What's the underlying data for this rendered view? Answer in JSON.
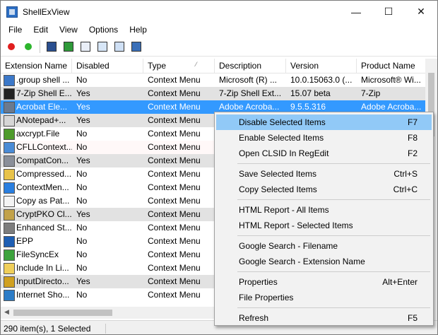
{
  "window": {
    "title": "ShellExView",
    "minimize": "—",
    "maximize": "☐",
    "close": "✕"
  },
  "menu": [
    "File",
    "Edit",
    "View",
    "Options",
    "Help"
  ],
  "columns": {
    "name": "Extension Name",
    "disabled": "Disabled",
    "type": "Type",
    "description": "Description",
    "version": "Version",
    "product": "Product Name"
  },
  "rows": [
    {
      "name": ".group shell ...",
      "disabled": "No",
      "type": "Context Menu",
      "description": "Microsoft (R) ...",
      "version": "10.0.15063.0 (...",
      "product": "Microsoft® Wi...",
      "style": "",
      "icon": "gear-doc-icon",
      "color": "#3b78c9"
    },
    {
      "name": "7-Zip Shell E...",
      "disabled": "Yes",
      "type": "Context Menu",
      "description": "7-Zip Shell Ext...",
      "version": "15.07 beta",
      "product": "7-Zip",
      "style": "grey",
      "icon": "7zip-icon",
      "color": "#222222"
    },
    {
      "name": "Acrobat Ele...",
      "disabled": "Yes",
      "type": "Context Menu",
      "description": "Adobe Acroba...",
      "version": "9.5.5.316",
      "product": "Adobe Acroba...",
      "style": "selected",
      "icon": "acrobat-icon",
      "color": "#6b7a8f"
    },
    {
      "name": "ANotepad+...",
      "disabled": "Yes",
      "type": "Context Menu",
      "description": "",
      "version": "",
      "product": "",
      "style": "grey",
      "icon": "notepad-icon",
      "color": "#d6d6d6"
    },
    {
      "name": "axcrypt.File",
      "disabled": "No",
      "type": "Context Menu",
      "description": "",
      "version": "",
      "product": "",
      "style": "",
      "icon": "shield-icon",
      "color": "#4d9b2c"
    },
    {
      "name": "CFLLContext...",
      "disabled": "No",
      "type": "Context Menu",
      "description": "",
      "version": "",
      "product": "",
      "style": "pinkish",
      "icon": "magnifier-icon",
      "color": "#4a8bd6"
    },
    {
      "name": "CompatCon...",
      "disabled": "Yes",
      "type": "Context Menu",
      "description": "",
      "version": "",
      "product": "",
      "style": "grey",
      "icon": "compat-icon",
      "color": "#8a8f99"
    },
    {
      "name": "Compressed...",
      "disabled": "No",
      "type": "Context Menu",
      "description": "",
      "version": "",
      "product": "",
      "style": "",
      "icon": "zip-folder-icon",
      "color": "#e8c34a"
    },
    {
      "name": "ContextMen...",
      "disabled": "No",
      "type": "Context Menu",
      "description": "",
      "version": "",
      "product": "",
      "style": "",
      "icon": "dropbox-icon",
      "color": "#2a7fe0"
    },
    {
      "name": "Copy as Pat...",
      "disabled": "No",
      "type": "Context Menu",
      "description": "",
      "version": "",
      "product": "",
      "style": "",
      "icon": "document-icon",
      "color": "#f4f4f4"
    },
    {
      "name": "CryptPKO Cl...",
      "disabled": "Yes",
      "type": "Context Menu",
      "description": "",
      "version": "",
      "product": "",
      "style": "grey",
      "icon": "certificate-icon",
      "color": "#c2a24a"
    },
    {
      "name": "Enhanced St...",
      "disabled": "No",
      "type": "Context Menu",
      "description": "",
      "version": "",
      "product": "",
      "style": "",
      "icon": "drive-icon",
      "color": "#7d7d7d"
    },
    {
      "name": "EPP",
      "disabled": "No",
      "type": "Context Menu",
      "description": "",
      "version": "",
      "product": "",
      "style": "",
      "icon": "epp-icon",
      "color": "#1e5fb4"
    },
    {
      "name": "FileSyncEx",
      "disabled": "No",
      "type": "Context Menu",
      "description": "",
      "version": "",
      "product": "",
      "style": "",
      "icon": "sync-check-icon",
      "color": "#3da33d"
    },
    {
      "name": "Include In Li...",
      "disabled": "No",
      "type": "Context Menu",
      "description": "",
      "version": "",
      "product": "",
      "style": "",
      "icon": "folder-icon",
      "color": "#f0cf5a"
    },
    {
      "name": "InputDirecto...",
      "disabled": "Yes",
      "type": "Context Menu",
      "description": "",
      "version": "",
      "product": "",
      "style": "grey",
      "icon": "input-icon",
      "color": "#d0a020"
    },
    {
      "name": "Internet Sho...",
      "disabled": "No",
      "type": "Context Menu",
      "description": "",
      "version": "",
      "product": "",
      "style": "",
      "icon": "globe-icon",
      "color": "#2b7cc7"
    }
  ],
  "status": {
    "count": "290 item(s), 1 Selected"
  },
  "context_menu": [
    {
      "label": "Disable Selected Items",
      "key": "F7",
      "highlight": true
    },
    {
      "label": "Enable Selected Items",
      "key": "F8"
    },
    {
      "label": "Open CLSID In RegEdit",
      "key": "F2"
    },
    {
      "sep": true
    },
    {
      "label": "Save Selected Items",
      "key": "Ctrl+S"
    },
    {
      "label": "Copy Selected Items",
      "key": "Ctrl+C"
    },
    {
      "sep": true
    },
    {
      "label": "HTML Report - All Items",
      "key": ""
    },
    {
      "label": "HTML Report - Selected Items",
      "key": ""
    },
    {
      "sep": true
    },
    {
      "label": "Google Search - Filename",
      "key": ""
    },
    {
      "label": "Google Search - Extension Name",
      "key": ""
    },
    {
      "sep": true
    },
    {
      "label": "Properties",
      "key": "Alt+Enter"
    },
    {
      "label": "File Properties",
      "key": ""
    },
    {
      "sep": true
    },
    {
      "label": "Refresh",
      "key": "F5"
    }
  ],
  "toolbar": [
    {
      "icon": "disable-red-dot-icon",
      "color": "#e01e1e"
    },
    {
      "icon": "enable-green-dot-icon",
      "color": "#2db52d"
    },
    {
      "sep": true
    },
    {
      "icon": "save-icon",
      "color": "#2a4f8f"
    },
    {
      "icon": "refresh-icon",
      "color": "#2f9a3a"
    },
    {
      "icon": "copy-icon",
      "color": "#e9eef7"
    },
    {
      "icon": "html-report-icon",
      "color": "#d7e6f7"
    },
    {
      "icon": "properties-icon",
      "color": "#cfe0f5"
    },
    {
      "icon": "exit-icon",
      "color": "#3a6fb8"
    }
  ]
}
